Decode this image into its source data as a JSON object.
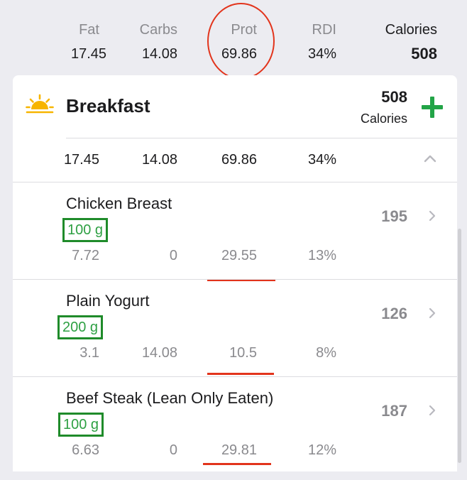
{
  "header": {
    "columns": [
      {
        "label": "Fat",
        "value": "17.45"
      },
      {
        "label": "Carbs",
        "value": "14.08"
      },
      {
        "label": "Prot",
        "value": "69.86"
      },
      {
        "label": "RDI",
        "value": "34%"
      },
      {
        "label": "Calories",
        "value": "508"
      }
    ]
  },
  "meal": {
    "icon": "sunrise-icon",
    "title": "Breakfast",
    "calories": "508",
    "calories_label": "Calories",
    "summary": {
      "fat": "17.45",
      "carbs": "14.08",
      "prot": "69.86",
      "rdi": "34%"
    }
  },
  "foods": [
    {
      "name": "Chicken Breast",
      "qty": "100 g",
      "fat": "7.72",
      "carbs": "0",
      "prot": "29.55",
      "rdi": "13%",
      "calories": "195"
    },
    {
      "name": "Plain Yogurt",
      "qty": "200 g",
      "fat": "3.1",
      "carbs": "14.08",
      "prot": "10.5",
      "rdi": "8%",
      "calories": "126"
    },
    {
      "name": "Beef Steak (Lean Only Eaten)",
      "qty": "100 g",
      "fat": "6.63",
      "carbs": "0",
      "prot": "29.81",
      "rdi": "12%",
      "calories": "187"
    }
  ],
  "colors": {
    "accent_green": "#2ea043",
    "annotation_red": "#e2341c"
  }
}
